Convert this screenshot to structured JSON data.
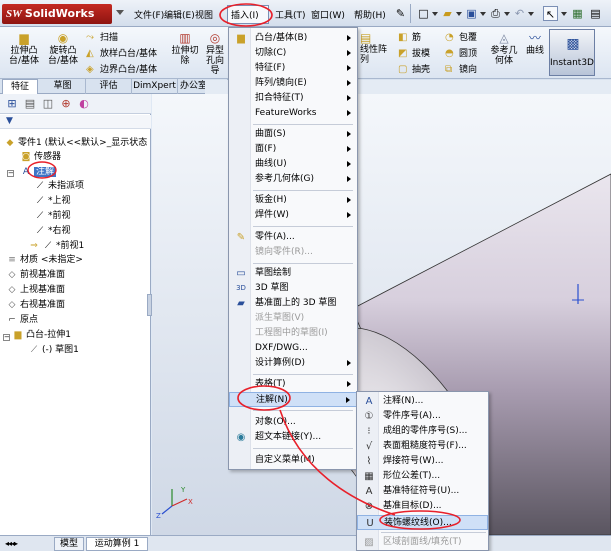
{
  "app": {
    "logo": "SolidWorks",
    "logo_mark": "SW"
  },
  "menubar": {
    "file": "文件(F)",
    "edit": "编辑(E)",
    "view": "视图",
    "insert": "插入(I)",
    "tools": "工具(T)",
    "window": "窗口(W)",
    "help": "帮助(H)"
  },
  "toolbar": {
    "boss_extrude": "拉伸凸台/基体",
    "revolve_boss": "旋转凸台/基体",
    "sweep": "扫描",
    "loft_boss": "放样凸台/基体",
    "boundary_boss": "边界凸台/基体",
    "extrude_cut": "拉伸切除",
    "hole_wizard": "异型孔向导",
    "linear_pattern": "线性阵列",
    "rib": "筋",
    "wrap": "包覆",
    "draft": "拔模",
    "dome": "圆顶",
    "shell": "抽壳",
    "mirror": "镜向",
    "reference_geometry": "参考几何体",
    "curves": "曲线",
    "instant3d": "Instant3D"
  },
  "tabs": [
    "特征",
    "草图",
    "评估",
    "DimXpert",
    "办公室产品"
  ],
  "feature_tree": {
    "root": "零件1 (默认<<默认>_显示状态",
    "sensors": "传感器",
    "annotations": "注解",
    "unassigned_items": "未指派项",
    "top_view": "*上视",
    "front_view": "*前视",
    "right_view": "*右视",
    "front_view_1": "*前视1",
    "material": "材质 <未指定>",
    "front_plane": "前视基准面",
    "top_plane": "上视基准面",
    "right_plane": "右视基准面",
    "origin": "原点",
    "boss_extrude_1": "凸台-拉伸1",
    "sketch_1": "(-) 草图1"
  },
  "insert_menu": [
    {
      "label": "凸台/基体(B)",
      "sub": true
    },
    {
      "label": "切除(C)",
      "sub": true
    },
    {
      "label": "特征(F)",
      "sub": true
    },
    {
      "label": "阵列/镜向(E)",
      "sub": true
    },
    {
      "label": "扣合特征(T)",
      "sub": true
    },
    {
      "label": "FeatureWorks",
      "sub": true
    },
    {
      "label": "曲面(S)",
      "sub": true
    },
    {
      "label": "面(F)",
      "sub": true
    },
    {
      "label": "曲线(U)",
      "sub": true
    },
    {
      "label": "参考几何体(G)",
      "sub": true
    },
    {
      "label": "钣金(H)",
      "sub": true
    },
    {
      "label": "焊件(W)",
      "sub": true
    },
    {
      "label": "零件(A)...",
      "sub": false
    },
    {
      "label": "镜向零件(R)...",
      "sub": false,
      "disabled": true
    },
    {
      "label": "草图绘制",
      "sub": false
    },
    {
      "label": "3D 草图",
      "sub": false
    },
    {
      "label": "基准面上的 3D 草图",
      "sub": false
    },
    {
      "label": "派生草图(V)",
      "sub": false,
      "disabled": true
    },
    {
      "label": "工程图中的草图(I)",
      "sub": false,
      "disabled": true
    },
    {
      "label": "DXF/DWG...",
      "sub": false
    },
    {
      "label": "设计算例(D)",
      "sub": true
    },
    {
      "label": "表格(T)",
      "sub": true
    },
    {
      "label": "注解(N)",
      "sub": true,
      "highlighted": true
    },
    {
      "label": "对象(O)...",
      "sub": false
    },
    {
      "label": "超文本链接(Y)...",
      "sub": false
    },
    {
      "label": "自定义菜单(M)",
      "sub": false
    }
  ],
  "annotation_menu": [
    {
      "label": "注释(N)..."
    },
    {
      "label": "零件序号(A)..."
    },
    {
      "label": "成组的零件序号(S)..."
    },
    {
      "label": "表面粗糙度符号(F)..."
    },
    {
      "label": "焊接符号(W)..."
    },
    {
      "label": "形位公差(T)..."
    },
    {
      "label": "基准特征符号(U)..."
    },
    {
      "label": "基准目标(D)..."
    },
    {
      "label": "装饰螺纹线(O)...",
      "highlighted": true
    },
    {
      "label": "区域剖面线/填充(T)",
      "disabled": true
    }
  ],
  "bottom_tabs": [
    "模型",
    "运动算例 1"
  ],
  "colors": {
    "annotation_red": "#e8202a",
    "selection_blue": "#3e74c6"
  }
}
